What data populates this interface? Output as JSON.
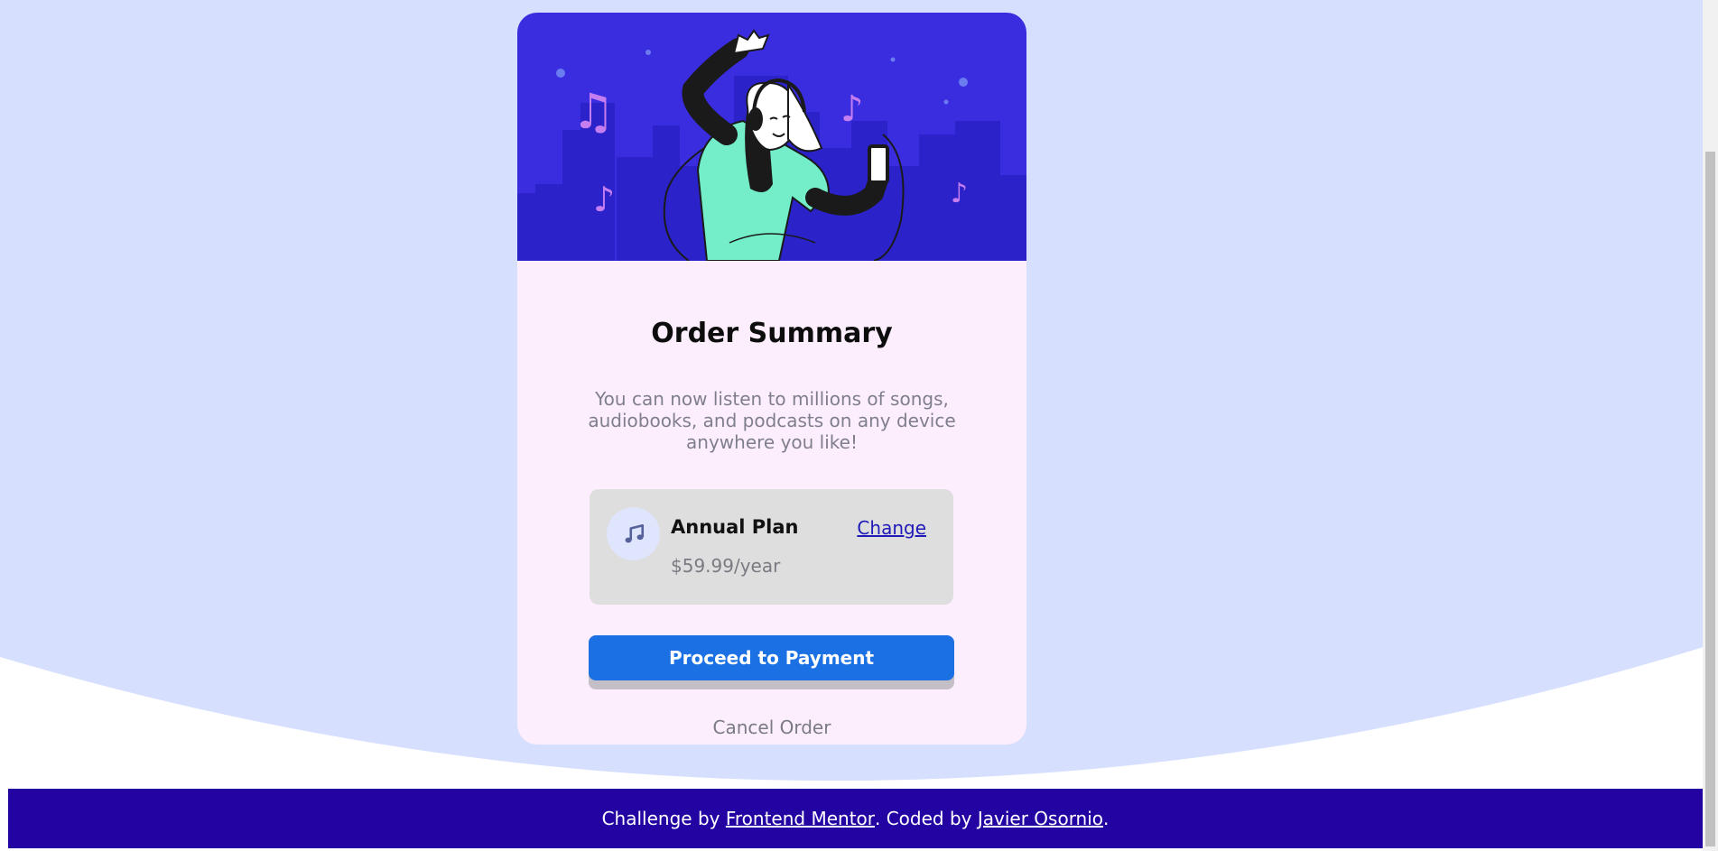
{
  "card": {
    "title": "Order Summary",
    "description": "You can now listen to millions of songs, audiobooks, and podcasts on any device anywhere you like!",
    "hero_image": "illustration-hero",
    "plan": {
      "icon": "music-note-icon",
      "name": "Annual Plan",
      "price": "$59.99/year",
      "change_label": "Change"
    },
    "proceed_label": "Proceed to Payment",
    "cancel_label": "Cancel Order"
  },
  "footer": {
    "prefix": "Challenge by ",
    "link1": "Frontend Mentor",
    "middle": ". Coded by ",
    "link2": "Javier Osornio",
    "suffix": "."
  },
  "colors": {
    "page_bg": "#d6e0fe",
    "card_bg": "#fdeefe",
    "hero_bg": "#3a2de0",
    "button": "#1b71e4",
    "footer_bg": "#2304a3"
  }
}
